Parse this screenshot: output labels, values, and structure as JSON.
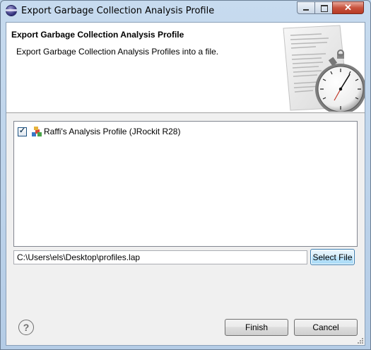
{
  "window": {
    "title": "Export Garbage Collection Analysis Profile",
    "controls": {
      "minimize": "—",
      "maximize": "□",
      "close": "✕"
    }
  },
  "banner": {
    "title": "Export Garbage Collection Analysis Profile",
    "description": "Export Garbage Collection Analysis Profiles into a file.",
    "art_icon": "stopwatch-document-illustration"
  },
  "profiles": {
    "items": [
      {
        "label": "Raffi's Analysis Profile (JRockit R28)",
        "checked": true,
        "icon": "profile-icon"
      }
    ]
  },
  "file": {
    "path": "C:\\Users\\els\\Desktop\\profiles.lap",
    "select_label": "Select File"
  },
  "footer": {
    "help_icon": "?",
    "finish_label": "Finish",
    "cancel_label": "Cancel"
  },
  "colors": {
    "title_bar": "#bcd3ea",
    "close_button": "#c8533e",
    "dialog_background": "#f0f0f0"
  }
}
